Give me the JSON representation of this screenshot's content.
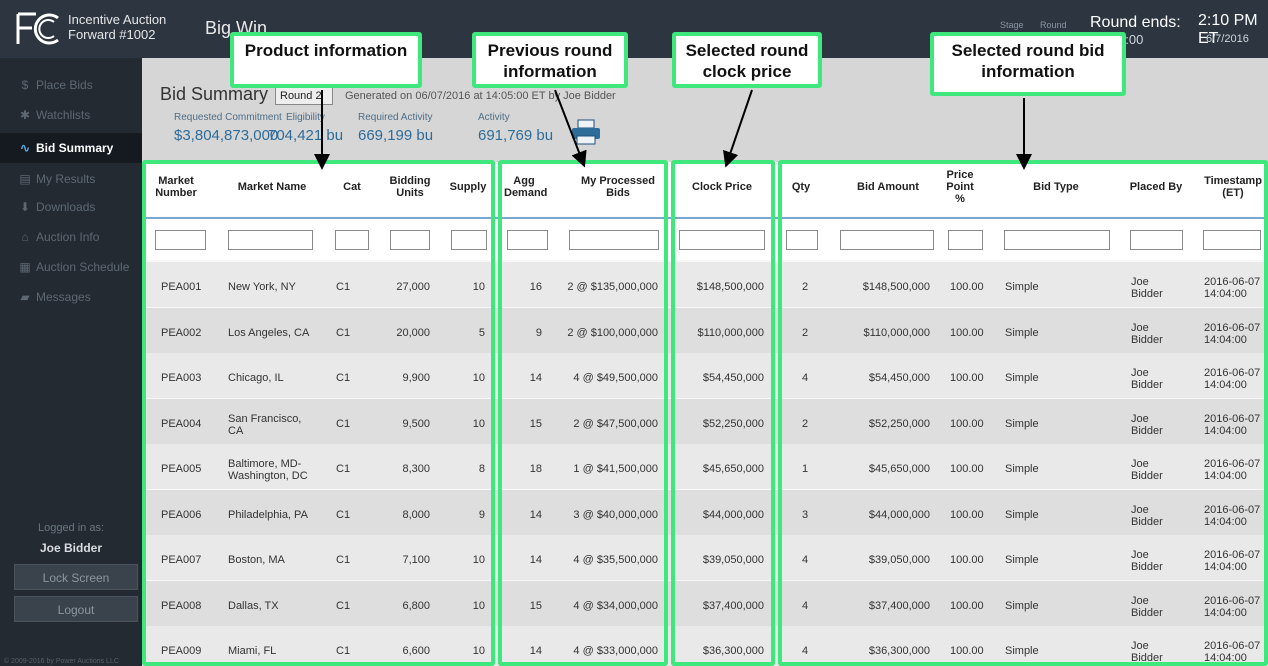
{
  "header": {
    "app_name_line1": "Incentive Auction",
    "app_name_line2": "Forward #1002",
    "page_heading": "Big Win",
    "stage_label": "Stage",
    "round_label": "Round",
    "round_ends": "Round ends:",
    "round_ends_time": "0:00",
    "clock_time": "2:10 PM ET",
    "clock_date": "6/7/2016"
  },
  "sidebar": {
    "items": [
      {
        "label": "Place Bids",
        "icon": "dollar-icon",
        "glyph": "$"
      },
      {
        "label": "Watchlists",
        "icon": "asterisk-icon",
        "glyph": "✱"
      },
      {
        "label": "Bid Summary",
        "icon": "pulse-icon",
        "glyph": "∿"
      },
      {
        "label": "My Results",
        "icon": "document-icon",
        "glyph": "▤"
      },
      {
        "label": "Downloads",
        "icon": "download-icon",
        "glyph": "⬇"
      },
      {
        "label": "Auction Info",
        "icon": "home-icon",
        "glyph": "⌂"
      },
      {
        "label": "Auction Schedule",
        "icon": "calendar-icon",
        "glyph": "▦"
      },
      {
        "label": "Messages",
        "icon": "chat-icon",
        "glyph": "▰"
      }
    ],
    "logged_in_label": "Logged in as:",
    "user_name": "Joe Bidder",
    "lock_screen": "Lock Screen",
    "logout": "Logout",
    "copyright": "© 2009-2016 by Power Auctions LLC"
  },
  "summary": {
    "title": "Bid Summary",
    "round_select": "Round 2",
    "generated": "Generated on 06/07/2016 at 14:05:00 ET by Joe Bidder",
    "stats": [
      {
        "label": "Requested Commitment",
        "value": "$3,804,873,000"
      },
      {
        "label": "Eligibility",
        "value": "704,421 bu"
      },
      {
        "label": "Required Activity",
        "value": "669,199 bu"
      },
      {
        "label": "Activity",
        "value": "691,769 bu"
      }
    ]
  },
  "table": {
    "headers": {
      "market_number": "Market Number",
      "market_name": "Market Name",
      "cat": "Cat",
      "bidding_units": "Bidding Units",
      "supply": "Supply",
      "agg_demand": "Agg Demand",
      "processed_bids": "My Processed Bids",
      "clock_price": "Clock Price",
      "qty": "Qty",
      "bid_amount": "Bid Amount",
      "price_point": "Price Point %",
      "bid_type": "Bid Type",
      "placed_by": "Placed By",
      "timestamp": "Timestamp (ET)"
    },
    "rows": [
      {
        "market_number": "PEA001",
        "market_name": "New York, NY",
        "cat": "C1",
        "bidding_units": "27,000",
        "supply": "10",
        "agg_demand": "16",
        "processed_bids": "2 @ $135,000,000",
        "clock_price": "$148,500,000",
        "qty": "2",
        "bid_amount": "$148,500,000",
        "price_point": "100.00",
        "bid_type": "Simple",
        "placed_by": "Joe Bidder",
        "timestamp": "2016-06-07 14:04:00"
      },
      {
        "market_number": "PEA002",
        "market_name": "Los Angeles, CA",
        "cat": "C1",
        "bidding_units": "20,000",
        "supply": "5",
        "agg_demand": "9",
        "processed_bids": "2 @ $100,000,000",
        "clock_price": "$110,000,000",
        "qty": "2",
        "bid_amount": "$110,000,000",
        "price_point": "100.00",
        "bid_type": "Simple",
        "placed_by": "Joe Bidder",
        "timestamp": "2016-06-07 14:04:00"
      },
      {
        "market_number": "PEA003",
        "market_name": "Chicago, IL",
        "cat": "C1",
        "bidding_units": "9,900",
        "supply": "10",
        "agg_demand": "14",
        "processed_bids": "4 @ $49,500,000",
        "clock_price": "$54,450,000",
        "qty": "4",
        "bid_amount": "$54,450,000",
        "price_point": "100.00",
        "bid_type": "Simple",
        "placed_by": "Joe Bidder",
        "timestamp": "2016-06-07 14:04:00"
      },
      {
        "market_number": "PEA004",
        "market_name": "San Francisco, CA",
        "cat": "C1",
        "bidding_units": "9,500",
        "supply": "10",
        "agg_demand": "15",
        "processed_bids": "2 @ $47,500,000",
        "clock_price": "$52,250,000",
        "qty": "2",
        "bid_amount": "$52,250,000",
        "price_point": "100.00",
        "bid_type": "Simple",
        "placed_by": "Joe Bidder",
        "timestamp": "2016-06-07 14:04:00"
      },
      {
        "market_number": "PEA005",
        "market_name": "Baltimore, MD-Washington, DC",
        "cat": "C1",
        "bidding_units": "8,300",
        "supply": "8",
        "agg_demand": "18",
        "processed_bids": "1 @ $41,500,000",
        "clock_price": "$45,650,000",
        "qty": "1",
        "bid_amount": "$45,650,000",
        "price_point": "100.00",
        "bid_type": "Simple",
        "placed_by": "Joe Bidder",
        "timestamp": "2016-06-07 14:04:00"
      },
      {
        "market_number": "PEA006",
        "market_name": "Philadelphia, PA",
        "cat": "C1",
        "bidding_units": "8,000",
        "supply": "9",
        "agg_demand": "14",
        "processed_bids": "3 @ $40,000,000",
        "clock_price": "$44,000,000",
        "qty": "3",
        "bid_amount": "$44,000,000",
        "price_point": "100.00",
        "bid_type": "Simple",
        "placed_by": "Joe Bidder",
        "timestamp": "2016-06-07 14:04:00"
      },
      {
        "market_number": "PEA007",
        "market_name": "Boston, MA",
        "cat": "C1",
        "bidding_units": "7,100",
        "supply": "10",
        "agg_demand": "14",
        "processed_bids": "4 @ $35,500,000",
        "clock_price": "$39,050,000",
        "qty": "4",
        "bid_amount": "$39,050,000",
        "price_point": "100.00",
        "bid_type": "Simple",
        "placed_by": "Joe Bidder",
        "timestamp": "2016-06-07 14:04:00"
      },
      {
        "market_number": "PEA008",
        "market_name": "Dallas, TX",
        "cat": "C1",
        "bidding_units": "6,800",
        "supply": "10",
        "agg_demand": "15",
        "processed_bids": "4 @ $34,000,000",
        "clock_price": "$37,400,000",
        "qty": "4",
        "bid_amount": "$37,400,000",
        "price_point": "100.00",
        "bid_type": "Simple",
        "placed_by": "Joe Bidder",
        "timestamp": "2016-06-07 14:04:00"
      },
      {
        "market_number": "PEA009",
        "market_name": "Miami, FL",
        "cat": "C1",
        "bidding_units": "6,600",
        "supply": "10",
        "agg_demand": "14",
        "processed_bids": "4 @ $33,000,000",
        "clock_price": "$36,300,000",
        "qty": "4",
        "bid_amount": "$36,300,000",
        "price_point": "100.00",
        "bid_type": "Simple",
        "placed_by": "Joe Bidder",
        "timestamp": "2016-06-07 14:04:00"
      }
    ]
  },
  "annotations": {
    "product": "Product information",
    "previous_round": "Previous round information",
    "clock_price": "Selected round clock price",
    "selected_round_bid": "Selected round bid information"
  },
  "colors": {
    "highlight": "#3ee87d",
    "topbar": "#2c3540",
    "sidebar": "#232a31",
    "accent_blue": "#2e6c99"
  }
}
